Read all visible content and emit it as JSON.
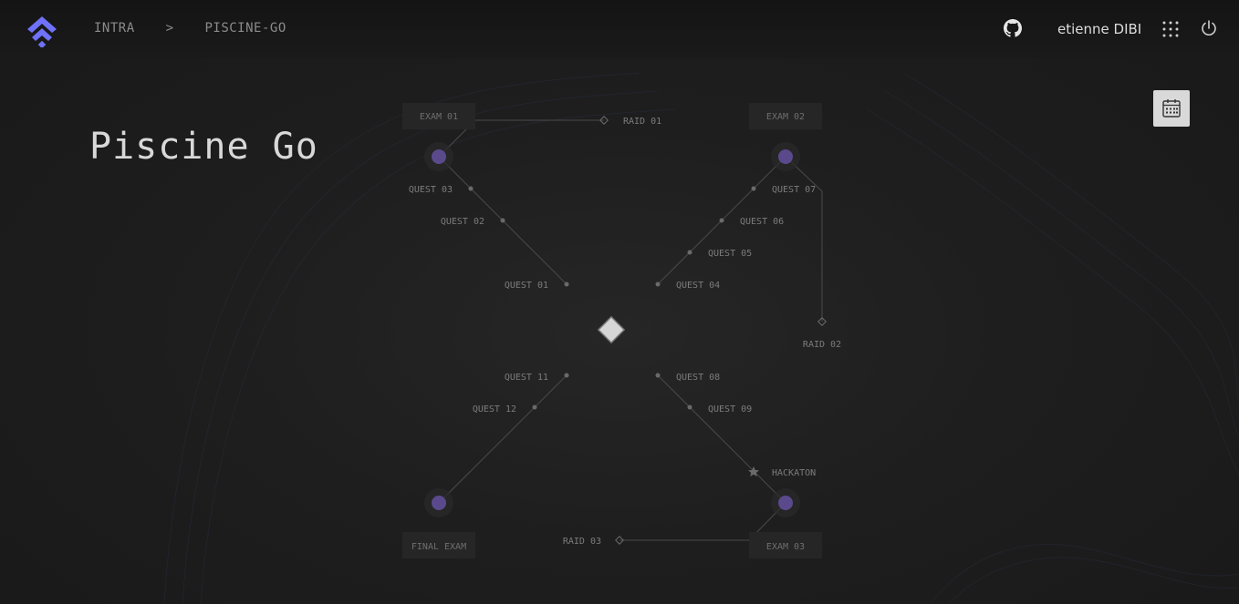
{
  "header": {
    "breadcrumb": [
      "INTRA",
      "PISCINE-GO"
    ],
    "breadcrumb_separator": ">",
    "username": "etienne DIBI",
    "icons": [
      "logo-icon",
      "github-icon",
      "apps-grid-icon",
      "power-icon"
    ]
  },
  "page": {
    "title": "Piscine Go",
    "calendar_icon": "calendar-icon"
  },
  "map": {
    "exam_01": "EXAM 01",
    "raid_01": "RAID 01",
    "exam_02": "EXAM 02",
    "quest_03": "QUEST 03",
    "quest_02": "QUEST 02",
    "quest_01": "QUEST 01",
    "quest_07": "QUEST 07",
    "quest_06": "QUEST 06",
    "quest_05": "QUEST 05",
    "quest_04": "QUEST 04",
    "raid_02": "RAID 02",
    "quest_11": "QUEST 11",
    "quest_12": "QUEST 12",
    "quest_08": "QUEST 08",
    "quest_09": "QUEST 09",
    "hackaton": "HACKATON",
    "final_exam": "FINAL EXAM",
    "raid_03": "RAID 03",
    "exam_03": "EXAM 03"
  },
  "colors": {
    "accent": "#6f72f7",
    "node_purple": "#5a4a8c",
    "background": "#1e1e1e"
  }
}
